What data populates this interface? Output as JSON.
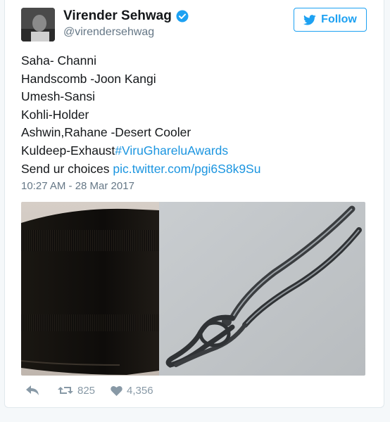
{
  "user": {
    "name": "Virender Sehwag",
    "handle": "@virendersehwag"
  },
  "follow_label": "Follow",
  "tweet": {
    "lines": [
      "Saha- Channi",
      "Handscomb -Joon Kangi",
      "Umesh-Sansi",
      "Kohli-Holder",
      "Ashwin,Rahane -Desert Cooler"
    ],
    "line6_text": "Kuldeep-Exhaust",
    "hashtag": "#ViruGhareluAwards",
    "line7_text": "Send ur choices ",
    "pic_link": "pic.twitter.com/pgi6S8k9Su"
  },
  "timestamp": "10:27 AM - 28 Mar 2017",
  "stats": {
    "retweets": "825",
    "likes": "4,356"
  },
  "colors": {
    "accent": "#1da1f2",
    "link": "#1b95e0",
    "muted": "#8899a6"
  },
  "icons": [
    "verified-badge-icon",
    "bird-icon",
    "reply-icon",
    "retweet-icon",
    "heart-icon"
  ]
}
